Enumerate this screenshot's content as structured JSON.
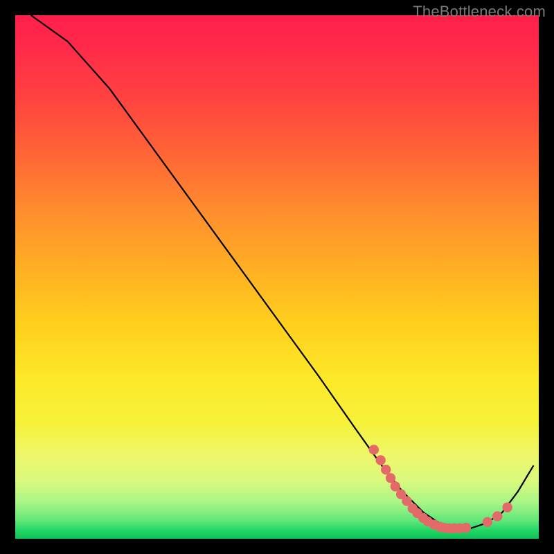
{
  "watermark": "TheBottleneck.com",
  "chart_data": {
    "type": "line",
    "title": "",
    "xlabel": "",
    "ylabel": "",
    "xlim": [
      0,
      100
    ],
    "ylim": [
      0,
      100
    ],
    "series": [
      {
        "name": "curve",
        "x": [
          3,
          10,
          18,
          26,
          34,
          42,
          50,
          58,
          65,
          70,
          74,
          78,
          81,
          84,
          87,
          90,
          93,
          96,
          99
        ],
        "y": [
          100,
          95,
          86,
          75,
          64,
          53,
          42,
          31,
          21,
          14,
          9,
          5,
          3,
          2,
          2,
          3,
          5,
          9,
          14
        ]
      }
    ],
    "markers": {
      "name": "highlight-dots",
      "x": [
        68.5,
        69.8,
        70.8,
        71.7,
        72.6,
        73.7,
        74.8,
        75.9,
        76.8,
        77.9,
        78.8,
        80.0,
        81.1,
        81.9,
        82.9,
        83.8,
        84.9,
        86.1,
        90.2,
        92.1,
        94.0
      ],
      "y": [
        17.0,
        15.0,
        13.2,
        11.6,
        10.0,
        8.5,
        7.2,
        5.8,
        4.9,
        4.0,
        3.3,
        2.7,
        2.3,
        2.1,
        2.0,
        2.0,
        2.0,
        2.1,
        3.2,
        4.3,
        6.0
      ]
    },
    "background_gradient": {
      "top": "#ff1f4a",
      "mid": "#ffd21e",
      "bottom": "#0fc257"
    }
  }
}
